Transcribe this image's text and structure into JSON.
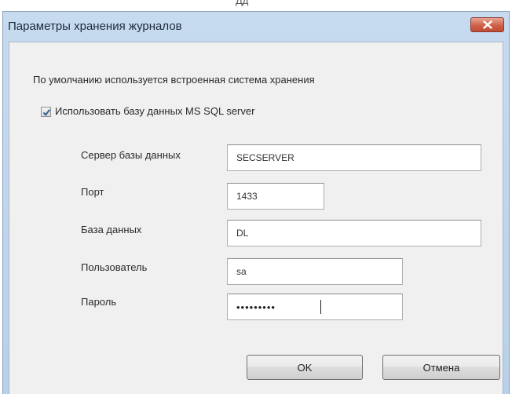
{
  "dialog": {
    "title": "Параметры хранения журналов",
    "info_text": "По умолчанию используется встроенная система хранения",
    "checkbox": {
      "label": "Использовать базу данных MS SQL server",
      "checked": true
    },
    "fields": {
      "server": {
        "label": "Сервер базы данных",
        "value": "SECSERVER"
      },
      "port": {
        "label": "Порт",
        "value": "1433"
      },
      "database": {
        "label": "База данных",
        "value": "DL"
      },
      "user": {
        "label": "Пользователь",
        "value": "sa"
      },
      "password": {
        "label": "Пароль",
        "value": "•••••••••"
      }
    },
    "buttons": {
      "ok": "OK",
      "cancel": "Отмена"
    }
  },
  "colors": {
    "title_bar": "#bcd3ec",
    "close_button": "#cf5d46",
    "dialog_background": "#f0f0f0"
  }
}
